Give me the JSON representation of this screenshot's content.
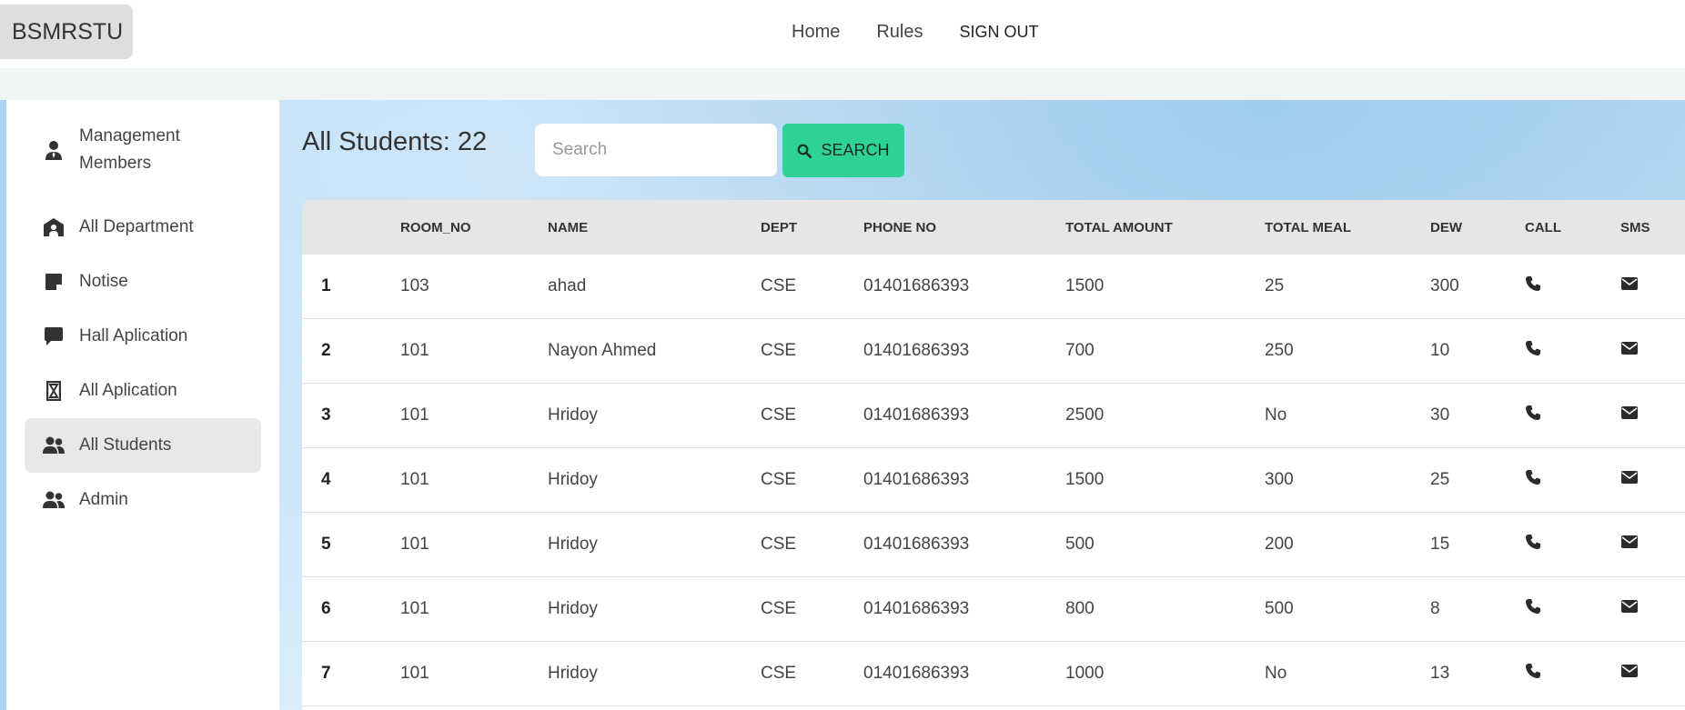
{
  "brand": "BSMRSTU",
  "nav": {
    "home": "Home",
    "rules": "Rules",
    "signout": "SIGN OUT"
  },
  "sidebar": {
    "items": [
      {
        "label_line1": "Management",
        "label_line2": "Members",
        "icon": "user-tie-icon"
      },
      {
        "label": "All Department",
        "icon": "school-icon"
      },
      {
        "label": "Notise",
        "icon": "sticky-note-icon"
      },
      {
        "label": "Hall Aplication",
        "icon": "comment-icon"
      },
      {
        "label": "All Aplication",
        "icon": "hourglass-icon"
      },
      {
        "label": "All Students",
        "icon": "users-icon",
        "active": true
      },
      {
        "label": "Admin",
        "icon": "users-icon"
      }
    ]
  },
  "main": {
    "title": "All Students: 22",
    "search_placeholder": "Search",
    "search_button": "SEARCH"
  },
  "table": {
    "headers": [
      "",
      "ROOM_NO",
      "NAME",
      "DEPT",
      "PHONE NO",
      "TOTAL AMOUNT",
      "TOTAL MEAL",
      "DEW",
      "CALL",
      "SMS"
    ],
    "rows": [
      [
        "1",
        "103",
        "ahad",
        "CSE",
        "01401686393",
        "1500",
        "25",
        "300"
      ],
      [
        "2",
        "101",
        "Nayon Ahmed",
        "CSE",
        "01401686393",
        "700",
        "250",
        "10"
      ],
      [
        "3",
        "101",
        "Hridoy",
        "CSE",
        "01401686393",
        "2500",
        "No",
        "30"
      ],
      [
        "4",
        "101",
        "Hridoy",
        "CSE",
        "01401686393",
        "1500",
        "300",
        "25"
      ],
      [
        "5",
        "101",
        "Hridoy",
        "CSE",
        "01401686393",
        "500",
        "200",
        "15"
      ],
      [
        "6",
        "101",
        "Hridoy",
        "CSE",
        "01401686393",
        "800",
        "500",
        "8"
      ],
      [
        "7",
        "101",
        "Hridoy",
        "CSE",
        "01401686393",
        "1000",
        "No",
        "13"
      ]
    ]
  },
  "colors": {
    "search_button": "#2fd296",
    "header_row": "#e6e6e6",
    "active_sidebar": "#e8e8e8"
  }
}
